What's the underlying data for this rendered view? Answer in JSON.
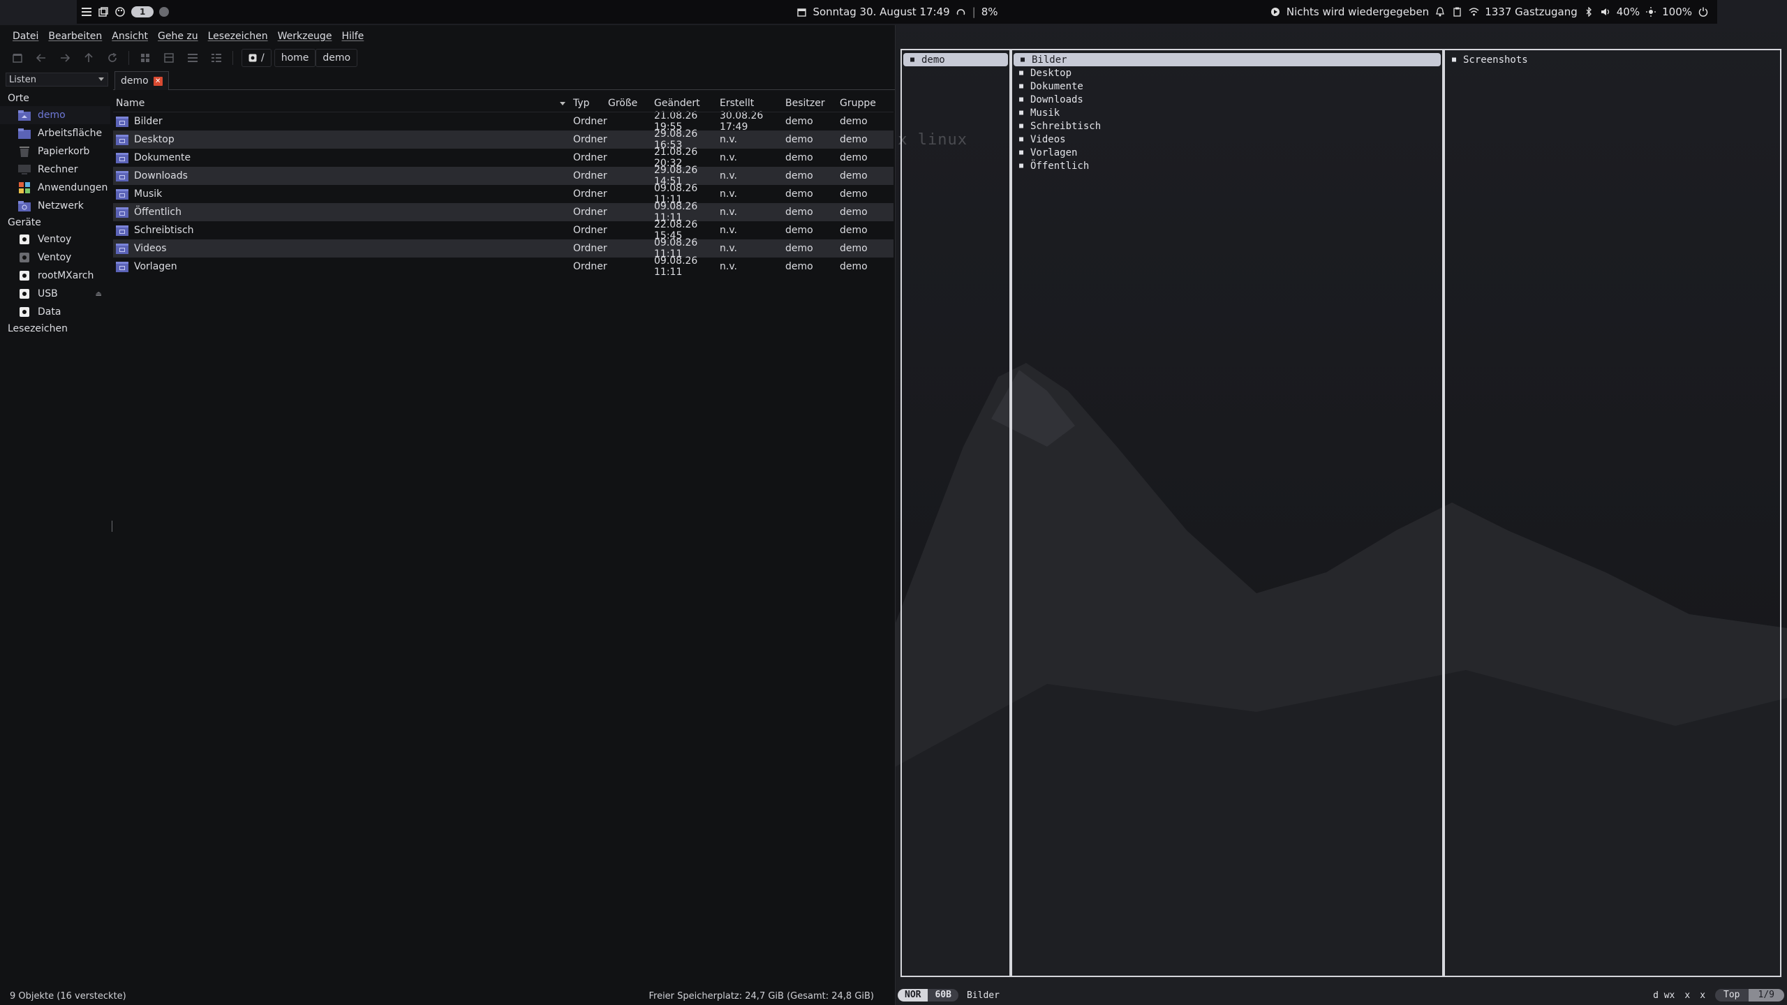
{
  "topbar": {
    "workspace": "1",
    "datetime": "Sonntag 30. August 17:49",
    "cpu": "8%",
    "media": "Nichts wird wiedergegeben",
    "network": "1337 Gastzugang",
    "volume": "40%",
    "brightness": "100%"
  },
  "menu": [
    "Datei",
    "Bearbeiten",
    "Ansicht",
    "Gehe zu",
    "Lesezeichen",
    "Werkzeuge",
    "Hilfe"
  ],
  "path": {
    "root": "/",
    "parts": [
      "home",
      "demo"
    ]
  },
  "side_combo": "Listen",
  "tab": {
    "label": "demo"
  },
  "sidebar": {
    "places_head": "Orte",
    "places": [
      {
        "label": "demo",
        "icon": "home-folder-icon"
      },
      {
        "label": "Arbeitsfläche",
        "icon": "desktop-folder-icon"
      },
      {
        "label": "Papierkorb",
        "icon": "trash-icon"
      },
      {
        "label": "Rechner",
        "icon": "computer-icon"
      },
      {
        "label": "Anwendungen",
        "icon": "applications-icon"
      },
      {
        "label": "Netzwerk",
        "icon": "network-folder-icon"
      }
    ],
    "devices_head": "Geräte",
    "devices": [
      {
        "label": "Ventoy",
        "icon": "drive-icon"
      },
      {
        "label": "Ventoy",
        "icon": "drive-icon"
      },
      {
        "label": "rootMXarch",
        "icon": "drive-icon"
      },
      {
        "label": "USB",
        "icon": "usb-drive-icon"
      },
      {
        "label": "Data",
        "icon": "drive-icon"
      }
    ],
    "bookmarks_head": "Lesezeichen"
  },
  "columns": {
    "name": "Name",
    "type": "Typ",
    "size": "Größe",
    "modified": "Geändert",
    "created": "Erstellt",
    "owner": "Besitzer",
    "group": "Gruppe"
  },
  "files": [
    {
      "name": "Bilder",
      "type": "Ordner",
      "size": "",
      "modified": "21.08.26 19:55",
      "created": "30.08.26 17:49",
      "owner": "demo",
      "group": "demo"
    },
    {
      "name": "Desktop",
      "type": "Ordner",
      "size": "",
      "modified": "29.08.26 16:53",
      "created": "n.v.",
      "owner": "demo",
      "group": "demo"
    },
    {
      "name": "Dokumente",
      "type": "Ordner",
      "size": "",
      "modified": "21.08.26 20:32",
      "created": "n.v.",
      "owner": "demo",
      "group": "demo"
    },
    {
      "name": "Downloads",
      "type": "Ordner",
      "size": "",
      "modified": "29.08.26 14:51",
      "created": "n.v.",
      "owner": "demo",
      "group": "demo"
    },
    {
      "name": "Musik",
      "type": "Ordner",
      "size": "",
      "modified": "09.08.26 11:11",
      "created": "n.v.",
      "owner": "demo",
      "group": "demo"
    },
    {
      "name": "Öffentlich",
      "type": "Ordner",
      "size": "",
      "modified": "09.08.26 11:11",
      "created": "n.v.",
      "owner": "demo",
      "group": "demo"
    },
    {
      "name": "Schreibtisch",
      "type": "Ordner",
      "size": "",
      "modified": "22.08.26 15:45",
      "created": "n.v.",
      "owner": "demo",
      "group": "demo"
    },
    {
      "name": "Videos",
      "type": "Ordner",
      "size": "",
      "modified": "09.08.26 11:11",
      "created": "n.v.",
      "owner": "demo",
      "group": "demo"
    },
    {
      "name": "Vorlagen",
      "type": "Ordner",
      "size": "",
      "modified": "09.08.26 11:11",
      "created": "n.v.",
      "owner": "demo",
      "group": "demo"
    }
  ],
  "status": {
    "count": "9 Objekte (16 versteckte)",
    "free": "Freier Speicherplatz: 24,7 GiB (Gesamt: 24,8 GiB)"
  },
  "logo_text": "sx linux",
  "ranger": {
    "parent": [
      "demo"
    ],
    "current": [
      "Bilder",
      "Desktop",
      "Dokumente",
      "Downloads",
      "Musik",
      "Schreibtisch",
      "Videos",
      "Vorlagen",
      "Öffentlich"
    ],
    "preview": [
      "Screenshots"
    ],
    "mode": "NOR",
    "size": "60B",
    "selected": "Bilder",
    "perms": "d wx",
    "flag1": "x",
    "flag2": "x",
    "position": "Top",
    "fraction": "1/9"
  }
}
